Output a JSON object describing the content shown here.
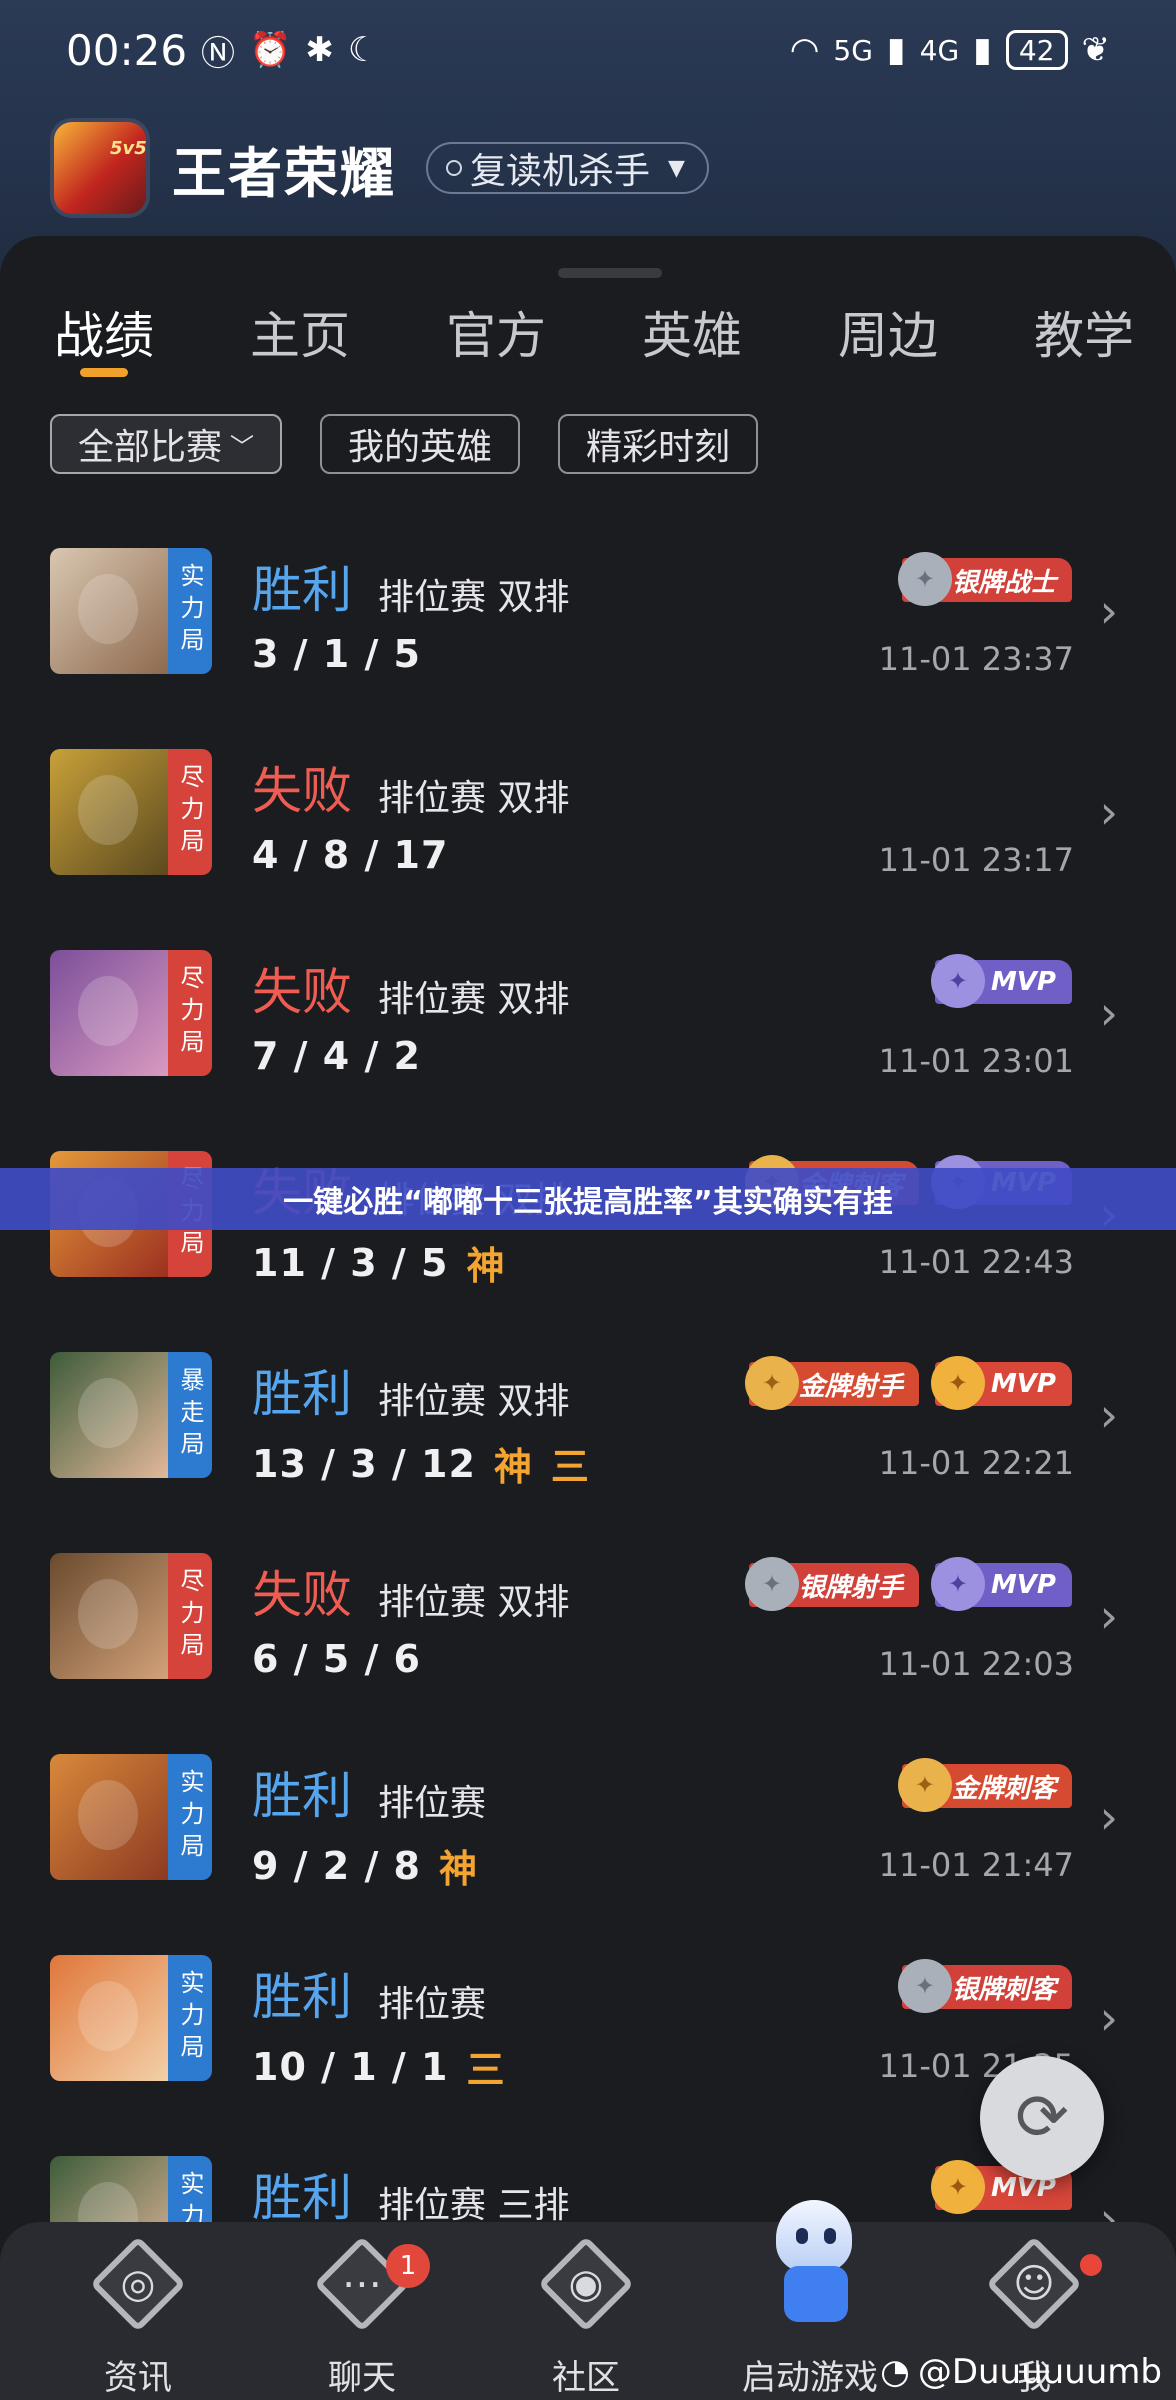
{
  "status_bar": {
    "time": "00:26",
    "network_5g": "5G",
    "network_4g": "4G",
    "battery": "42"
  },
  "header": {
    "game_icon_badge": "5v5",
    "title": "王者荣耀",
    "server_name": "复读机杀手"
  },
  "tabs": [
    "战绩",
    "主页",
    "官方",
    "英雄",
    "周边",
    "教学"
  ],
  "filters": [
    "全部比赛",
    "我的英雄",
    "精彩时刻"
  ],
  "matches": [
    {
      "tag": "实力局",
      "tag_color": "#2d7bd0",
      "result": "胜利",
      "win": true,
      "mode": "排位赛 双排",
      "kda": "3 / 1 / 5",
      "marks": [],
      "badges": [
        {
          "type": "silver",
          "text": "银牌战士"
        }
      ],
      "time": "11-01 23:37",
      "avatar_colors": [
        "#d9c7b2",
        "#8e6a4e"
      ]
    },
    {
      "tag": "尽力局",
      "tag_color": "#d6433b",
      "result": "失败",
      "win": false,
      "mode": "排位赛 双排",
      "kda": "4 / 8 / 17",
      "marks": [],
      "badges": [],
      "time": "11-01 23:17",
      "avatar_colors": [
        "#c9a13a",
        "#5b4a1f"
      ]
    },
    {
      "tag": "尽力局",
      "tag_color": "#d6433b",
      "result": "失败",
      "win": false,
      "mode": "排位赛 双排",
      "kda": "7 / 4 / 2",
      "marks": [],
      "badges": [
        {
          "type": "mvp-silver",
          "text": "MVP"
        }
      ],
      "time": "11-01 23:01",
      "avatar_colors": [
        "#7c4f9a",
        "#d89ac0"
      ]
    },
    {
      "tag": "尽力局",
      "tag_color": "#d6433b",
      "result": "失败",
      "win": false,
      "mode": "排位赛 双排",
      "kda": "11 / 3 / 5",
      "marks": [
        "神"
      ],
      "badges": [
        {
          "type": "gold",
          "text": "金牌刺客"
        },
        {
          "type": "mvp-silver",
          "text": "MVP"
        }
      ],
      "time": "11-01 22:43",
      "avatar_colors": [
        "#e49a3b",
        "#9c3020"
      ]
    },
    {
      "tag": "暴走局",
      "tag_color": "#2d7bd0",
      "result": "胜利",
      "win": true,
      "mode": "排位赛 双排",
      "kda": "13 / 3 / 12",
      "marks": [
        "神",
        "三"
      ],
      "badges": [
        {
          "type": "gold",
          "text": "金牌射手"
        },
        {
          "type": "mvp-gold",
          "text": "MVP"
        }
      ],
      "time": "11-01 22:21",
      "avatar_colors": [
        "#3d5c3a",
        "#e2b89a"
      ]
    },
    {
      "tag": "尽力局",
      "tag_color": "#d6433b",
      "result": "失败",
      "win": false,
      "mode": "排位赛 双排",
      "kda": "6 / 5 / 6",
      "marks": [],
      "badges": [
        {
          "type": "silver",
          "text": "银牌射手"
        },
        {
          "type": "mvp-silver",
          "text": "MVP"
        }
      ],
      "time": "11-01 22:03",
      "avatar_colors": [
        "#6a4a2e",
        "#d2a27a"
      ]
    },
    {
      "tag": "实力局",
      "tag_color": "#2d7bd0",
      "result": "胜利",
      "win": true,
      "mode": "排位赛",
      "kda": "9 / 2 / 8",
      "marks": [
        "神"
      ],
      "badges": [
        {
          "type": "gold",
          "text": "金牌刺客"
        }
      ],
      "time": "11-01 21:47",
      "avatar_colors": [
        "#d9893a",
        "#8c3a22"
      ]
    },
    {
      "tag": "实力局",
      "tag_color": "#2d7bd0",
      "result": "胜利",
      "win": true,
      "mode": "排位赛",
      "kda": "10 / 1 / 1",
      "marks": [
        "三"
      ],
      "badges": [
        {
          "type": "silver",
          "text": "银牌刺客"
        }
      ],
      "time": "11-01 21:25",
      "avatar_colors": [
        "#e0773a",
        "#f2d0a8"
      ]
    },
    {
      "tag": "实力局",
      "tag_color": "#2d7bd0",
      "result": "胜利",
      "win": true,
      "mode": "排位赛 三排",
      "kda": "",
      "marks": [],
      "badges": [
        {
          "type": "mvp-gold",
          "text": "MVP"
        }
      ],
      "time": "",
      "avatar_colors": [
        "#3d5c3a",
        "#e2b89a"
      ]
    }
  ],
  "banner_text": "一键必胜“嘟嘟十三张提高胜率”其实确实有挂",
  "bottom_nav": [
    {
      "label": "资讯",
      "icon": "news-icon",
      "badge": ""
    },
    {
      "label": "聊天",
      "icon": "chat-icon",
      "badge": "1"
    },
    {
      "label": "社区",
      "icon": "community-icon",
      "badge": ""
    },
    {
      "label": "启动游戏",
      "icon": "launch-game-mascot-icon",
      "badge": ""
    },
    {
      "label": "我",
      "icon": "profile-icon",
      "badge": "dot"
    }
  ],
  "watermark": "@Duuuuuumb"
}
